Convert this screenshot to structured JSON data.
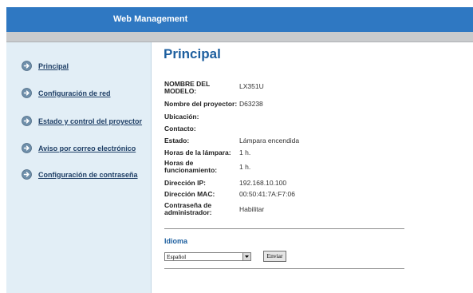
{
  "header": {
    "title": "Web Management"
  },
  "sidebar": {
    "items": [
      {
        "label": "Principal"
      },
      {
        "label": "Configuración de red"
      },
      {
        "label": "Estado y control del proyector"
      },
      {
        "label": "Aviso por correo electrónico"
      },
      {
        "label": "Configuración de contraseña"
      }
    ]
  },
  "main": {
    "title": "Principal",
    "info": [
      {
        "label": "NOMBRE DEL MODELO:",
        "value": "LX351U"
      },
      {
        "label": "Nombre del proyector:",
        "value": "D63238"
      },
      {
        "label": "Ubicación:",
        "value": ""
      },
      {
        "label": "Contacto:",
        "value": ""
      },
      {
        "label": "Estado:",
        "value": "Lámpara encendida"
      },
      {
        "label": "Horas de la lámpara:",
        "value": "1 h."
      },
      {
        "label": "Horas de funcionamiento:",
        "value": "1 h."
      },
      {
        "label": "Dirección IP:",
        "value": "192.168.10.100"
      },
      {
        "label": "Dirección MAC:",
        "value": "00:50:41:7A:F7:06"
      },
      {
        "label": "Contraseña de administrador:",
        "value": "Habilitar"
      }
    ],
    "language": {
      "label": "Idioma",
      "selected": "Español",
      "submit": "Enviar"
    }
  },
  "colors": {
    "header_bg": "#2f78c2",
    "sidebar_bg": "#e2eef6",
    "title_blue": "#1d5f9f"
  },
  "icons": {
    "nav": "arrow-circle-right-icon"
  }
}
